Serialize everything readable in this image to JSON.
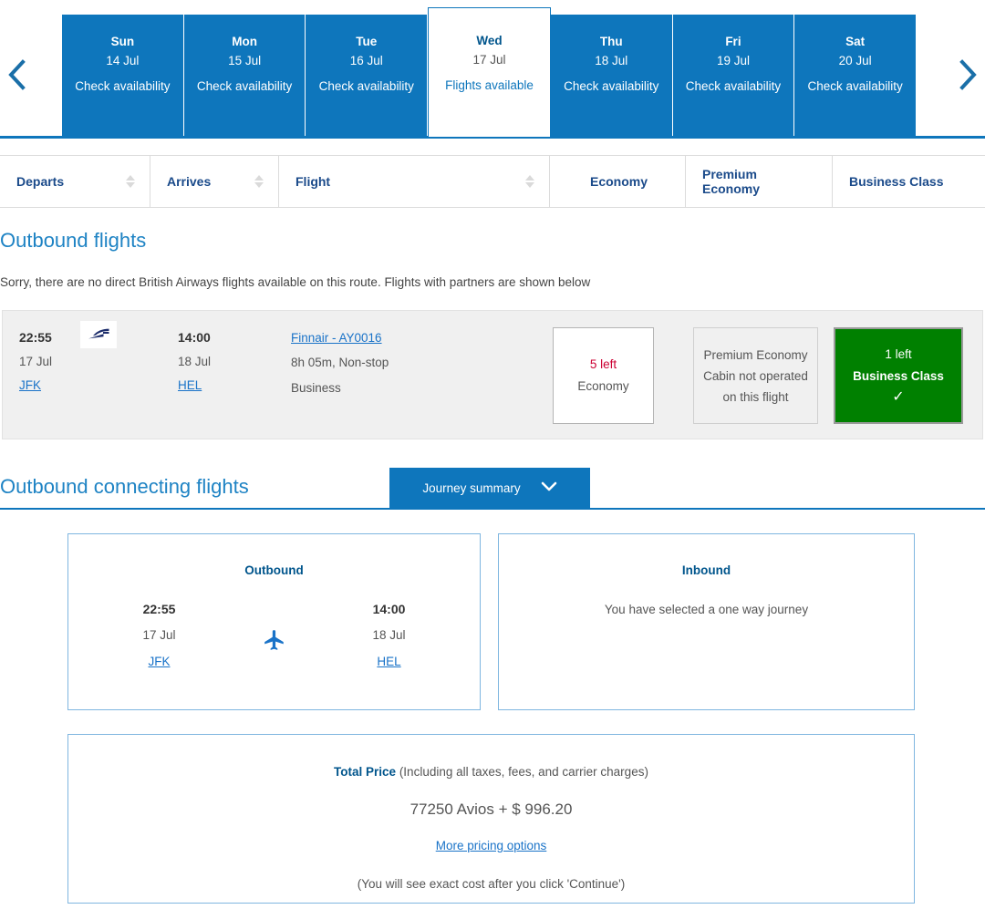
{
  "date_strip": {
    "prev_label": "Previous dates",
    "next_label": "Next dates",
    "days": [
      {
        "dow": "Sun",
        "date": "14 Jul",
        "availability": "Check availability",
        "selected": false
      },
      {
        "dow": "Mon",
        "date": "15 Jul",
        "availability": "Check availability",
        "selected": false
      },
      {
        "dow": "Tue",
        "date": "16 Jul",
        "availability": "Check availability",
        "selected": false
      },
      {
        "dow": "Wed",
        "date": "17 Jul",
        "availability": "Flights available",
        "selected": true
      },
      {
        "dow": "Thu",
        "date": "18 Jul",
        "availability": "Check availability",
        "selected": false
      },
      {
        "dow": "Fri",
        "date": "19 Jul",
        "availability": "Check availability",
        "selected": false
      },
      {
        "dow": "Sat",
        "date": "20 Jul",
        "availability": "Check availability",
        "selected": false
      }
    ]
  },
  "sort_header": {
    "departs": "Departs",
    "arrives": "Arrives",
    "flight": "Flight",
    "economy": "Economy",
    "premium_economy": "Premium Economy",
    "business_class": "Business Class"
  },
  "outbound": {
    "title": "Outbound flights",
    "notice": "Sorry, there are no direct British Airways flights available on this route. Flights with partners are shown below",
    "flight": {
      "depart_time": "22:55",
      "depart_date": "17 Jul",
      "depart_airport": "JFK",
      "airline_logo": "finnair-logo",
      "arrive_time": "14:00",
      "arrive_date": "18 Jul",
      "arrive_airport": "HEL",
      "flight_number": "Finnair - AY0016",
      "duration": "8h 05m, Non-stop",
      "cabin": "Business",
      "cabins": {
        "economy": {
          "seats_left": "5 left",
          "label": "Economy"
        },
        "premium": {
          "line1": "Premium Economy",
          "line2": "Cabin not operated",
          "line3": "on this flight"
        },
        "business": {
          "seats_left": "1 left",
          "label": "Business Class",
          "selected_mark": "✓"
        }
      }
    }
  },
  "connecting": {
    "title": "Outbound connecting flights",
    "journey_summary_tab": "Journey summary"
  },
  "journey_summary": {
    "outbound": {
      "title": "Outbound",
      "depart_time": "22:55",
      "depart_date": "17 Jul",
      "depart_airport": "JFK",
      "arrive_time": "14:00",
      "arrive_date": "18 Jul",
      "arrive_airport": "HEL"
    },
    "inbound": {
      "title": "Inbound",
      "message": "You have selected a one way journey"
    },
    "price": {
      "label": "Total Price",
      "label_suffix": " (Including all taxes, fees, and carrier charges)",
      "amount": "77250 Avios + $ 996.20",
      "more_options": "More pricing options",
      "note": "(You will see exact cost after you click 'Continue')"
    }
  },
  "colors": {
    "ba_blue": "#0e76bc",
    "dark_blue": "#00558c",
    "link_blue": "#1a73c8",
    "heading_blue": "#1e83c4",
    "green": "#008000",
    "red": "#cc0033"
  }
}
